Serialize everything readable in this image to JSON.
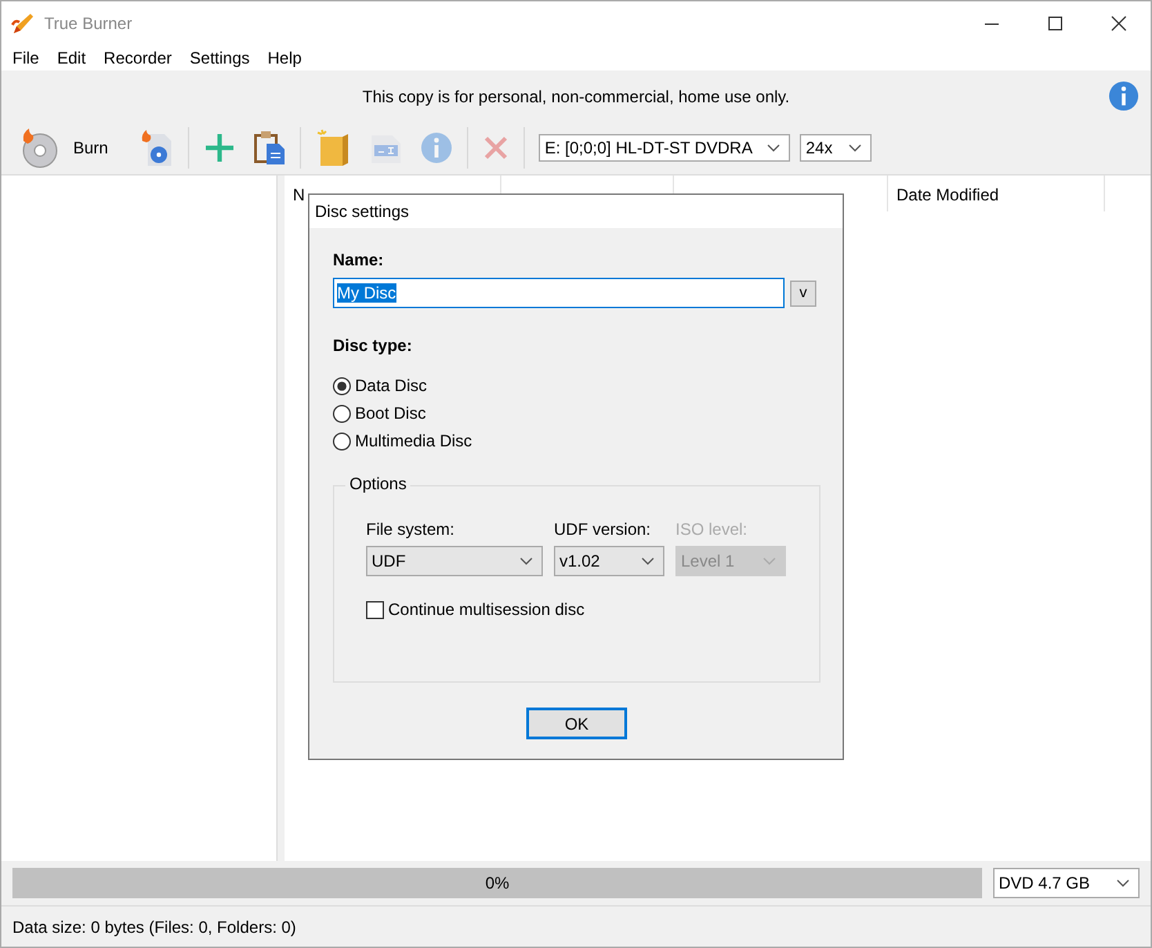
{
  "window": {
    "title": "True Burner"
  },
  "menu": [
    "File",
    "Edit",
    "Recorder",
    "Settings",
    "Help"
  ],
  "banner": {
    "text": "This copy is for personal, non-commercial, home use only."
  },
  "toolbar": [
    {
      "kind": "burn",
      "label": "Burn",
      "disabled": false
    },
    {
      "kind": "image",
      "disabled": false
    },
    {
      "kind": "sep"
    },
    {
      "kind": "add",
      "disabled": false
    },
    {
      "kind": "paste",
      "disabled": false
    },
    {
      "kind": "sep"
    },
    {
      "kind": "folder",
      "disabled": false
    },
    {
      "kind": "rename",
      "disabled": true
    },
    {
      "kind": "info",
      "disabled": true
    },
    {
      "kind": "sep"
    },
    {
      "kind": "delete",
      "disabled": true
    },
    {
      "kind": "sep"
    }
  ],
  "drive": {
    "value": "E:  [0;0;0] HL-DT-ST DVDRA"
  },
  "speed": {
    "value": "24x"
  },
  "columns": [
    {
      "label": "N"
    },
    {
      "label": "Date Modified"
    }
  ],
  "dialog": {
    "title": "Disc settings",
    "name_label": "Name:",
    "name_value": "My Disc",
    "name_button": "v",
    "disc_type_label": "Disc type:",
    "disc_types": [
      {
        "label": "Data Disc",
        "selected": true
      },
      {
        "label": "Boot Disc",
        "selected": false
      },
      {
        "label": "Multimedia Disc",
        "selected": false
      }
    ],
    "options": {
      "title": "Options",
      "selects": [
        {
          "label": "File system:",
          "value": "UDF",
          "disabled": false
        },
        {
          "label": "UDF version:",
          "value": "v1.02",
          "disabled": false
        },
        {
          "label": "ISO level:",
          "value": "Level 1",
          "disabled": true
        }
      ],
      "multisession": {
        "label": "Continue multisession disc",
        "checked": false
      }
    },
    "ok": "OK"
  },
  "progress": {
    "level": 0,
    "text": "0%"
  },
  "media": {
    "value": "DVD 4.7 GB"
  },
  "status_bar": "Data size: 0 bytes (Files: 0, Folders: 0)"
}
